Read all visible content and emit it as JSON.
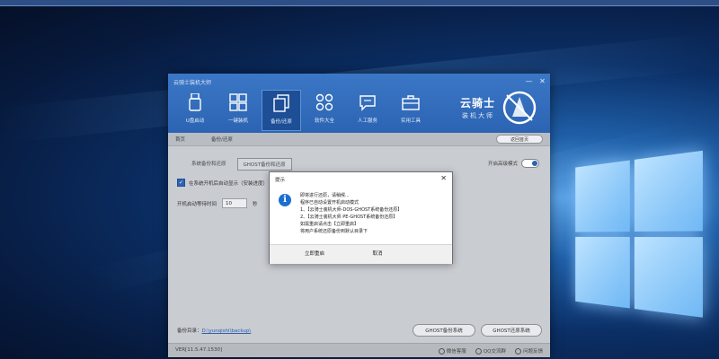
{
  "app": {
    "title": "云骑士装机大师",
    "controls": {
      "minimize": "—",
      "close": "✕"
    },
    "nav": [
      {
        "label": "U盘启动",
        "icon": "usb-icon"
      },
      {
        "label": "一键装机",
        "icon": "windows-icon"
      },
      {
        "label": "备份/还原",
        "icon": "backup-icon",
        "active": true
      },
      {
        "label": "软件大全",
        "icon": "apps-icon"
      },
      {
        "label": "人工服务",
        "icon": "chat-icon"
      },
      {
        "label": "实用工具",
        "icon": "toolbox-icon"
      }
    ],
    "brand": {
      "name": "云骑士",
      "sub": "装机大师"
    },
    "breadcrumb": {
      "home": "首页",
      "current": "备份/还原"
    },
    "back_button": "返回首页",
    "tabs": [
      {
        "label": "系统备份和还原"
      },
      {
        "label": "GHOST备份和还原",
        "active": true
      }
    ],
    "advanced_mode_label": "开启高级模式",
    "option_label": "在系统开机后自动显示（安装进度）",
    "wait_label": "开机启动等待时间",
    "wait_value": "10",
    "wait_unit": "秒",
    "footer": {
      "label": "备份目录：",
      "path": "D:\\yunqishi\\backup\\"
    },
    "ghost_backup_btn": "GHOST备份系统",
    "ghost_restore_btn": "GHOST还原系统",
    "version": "VER[11.5.47.1530]",
    "status_links": [
      "微信客服",
      "QQ交流群",
      "问题反馈"
    ]
  },
  "dialog": {
    "title": "提示",
    "lines": [
      "即将进行还原，请稍候...",
      "程序已自动设置开机启动模式",
      "1、【云骑士装机大师-DOS-GHOST系统备份还原】",
      "2、【云骑士装机大师 PE-GHOST系统备份还原】",
      "如需重启请点击【立即重启】",
      "将用户系统还原备份到默认目录下"
    ],
    "restart_btn": "立即重启",
    "cancel_btn": "取消"
  }
}
